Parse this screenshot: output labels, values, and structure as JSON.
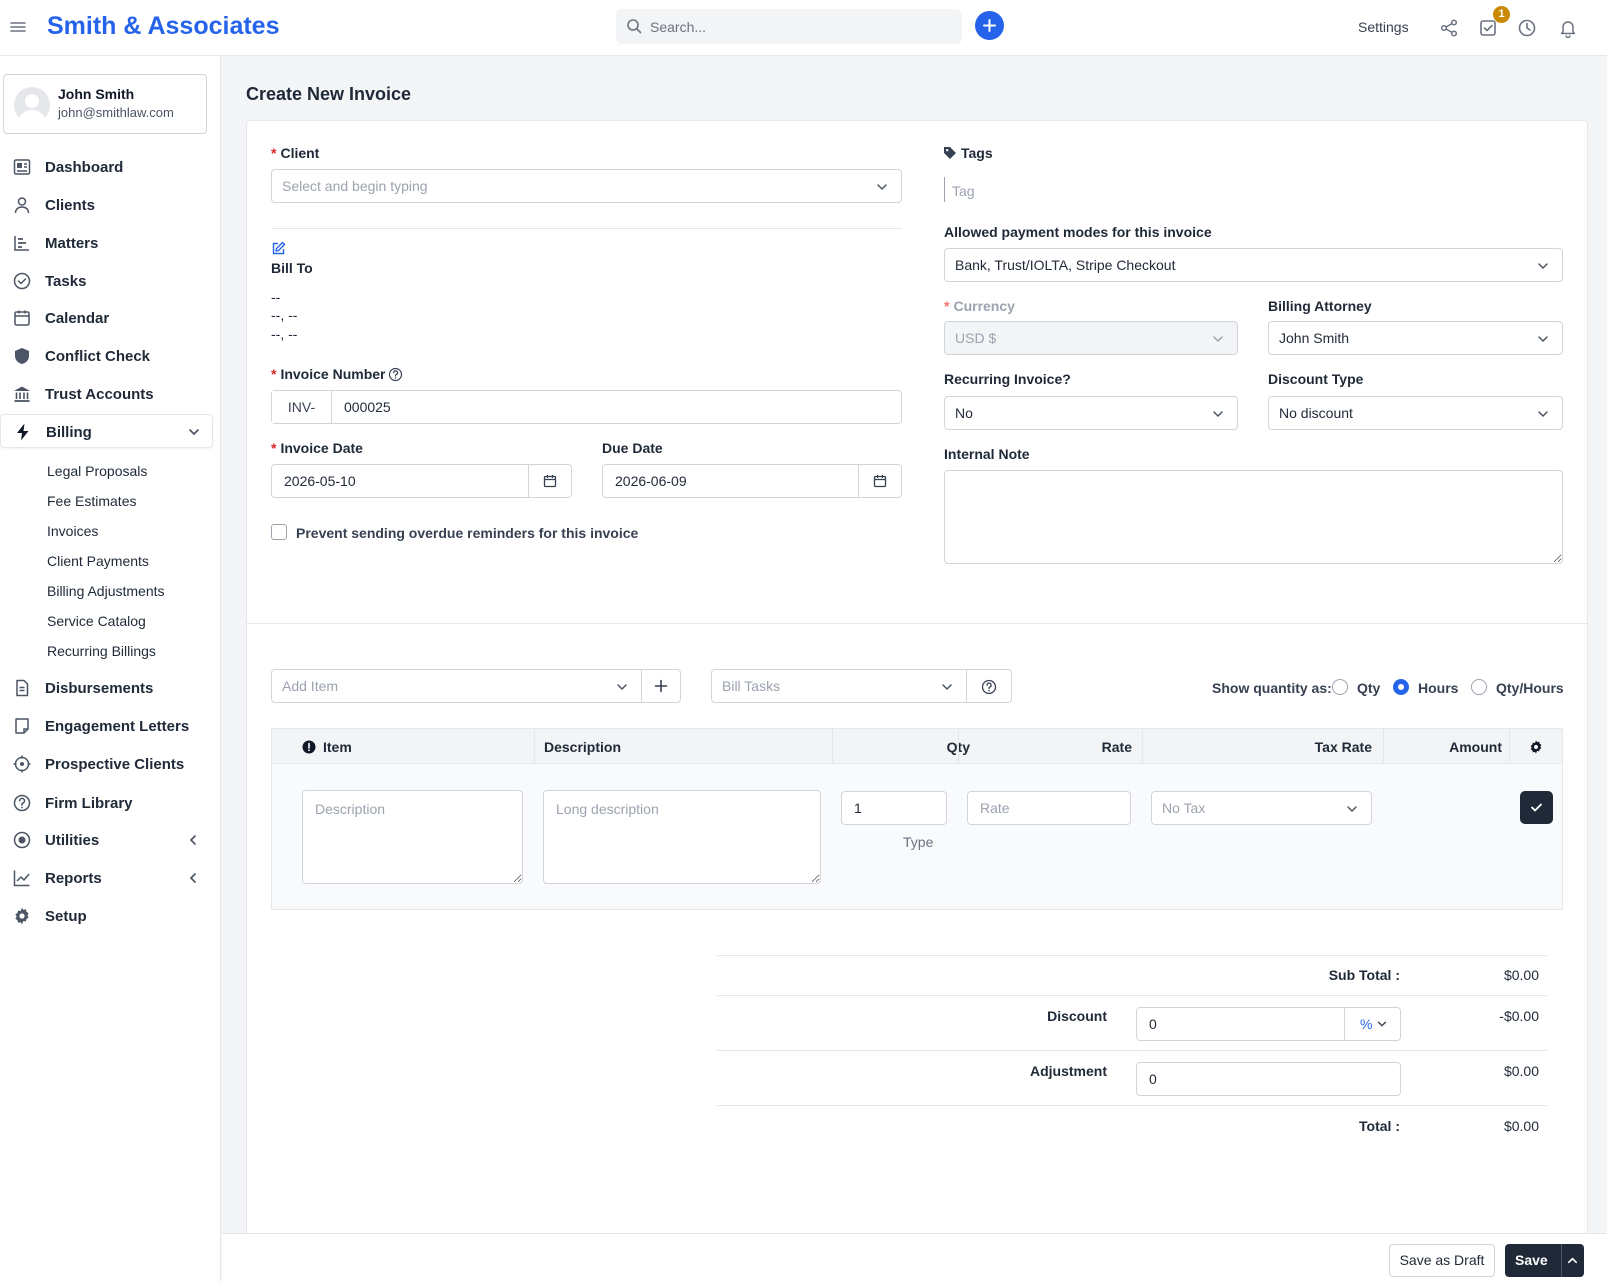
{
  "header": {
    "brand": "Smith & Associates",
    "search_placeholder": "Search...",
    "settings_label": "Settings",
    "tasks_badge": "1"
  },
  "user": {
    "name": "John Smith",
    "email": "john@smithlaw.com"
  },
  "nav": {
    "dashboard": "Dashboard",
    "clients": "Clients",
    "matters": "Matters",
    "tasks": "Tasks",
    "calendar": "Calendar",
    "conflict_check": "Conflict Check",
    "trust_accounts": "Trust Accounts",
    "billing": "Billing",
    "billing_sub": [
      "Legal Proposals",
      "Fee Estimates",
      "Invoices",
      "Client Payments",
      "Billing Adjustments",
      "Service Catalog",
      "Recurring Billings"
    ],
    "disbursements": "Disbursements",
    "engagement_letters": "Engagement Letters",
    "prospective_clients": "Prospective Clients",
    "firm_library": "Firm Library",
    "utilities": "Utilities",
    "reports": "Reports",
    "setup": "Setup"
  },
  "page": {
    "title": "Create New Invoice"
  },
  "form": {
    "client_label": "Client",
    "client_placeholder": "Select and begin typing",
    "bill_to_label": "Bill To",
    "bill_to_lines": [
      "--",
      "--, --",
      "--, --"
    ],
    "invoice_number_label": "Invoice Number",
    "invoice_prefix": "INV-",
    "invoice_number": "000025",
    "invoice_date_label": "Invoice Date",
    "invoice_date": "2026-05-10",
    "due_date_label": "Due Date",
    "due_date": "2026-06-09",
    "prevent_reminders_label": "Prevent sending overdue reminders for this invoice",
    "tags_label": "Tags",
    "tag_placeholder": "Tag",
    "payment_modes_label": "Allowed payment modes for this invoice",
    "payment_modes_value": "Bank, Trust/IOLTA, Stripe Checkout",
    "currency_label": "Currency",
    "currency_value": "USD $",
    "billing_attorney_label": "Billing Attorney",
    "billing_attorney_value": "John Smith",
    "recurring_label": "Recurring Invoice?",
    "recurring_value": "No",
    "discount_type_label": "Discount Type",
    "discount_type_value": "No discount",
    "internal_note_label": "Internal Note"
  },
  "items": {
    "add_item_placeholder": "Add Item",
    "bill_tasks_placeholder": "Bill Tasks",
    "show_qty_label": "Show quantity as:",
    "qty_options": [
      "Qty",
      "Hours",
      "Qty/Hours"
    ],
    "qty_selected": "Hours",
    "columns": [
      "Item",
      "Description",
      "Qty",
      "Rate",
      "Tax Rate",
      "Amount"
    ],
    "row": {
      "description_placeholder": "Description",
      "long_description_placeholder": "Long description",
      "qty": "1",
      "type_label": "Type",
      "rate_placeholder": "Rate",
      "tax_value": "No Tax"
    }
  },
  "totals": {
    "sub_total_label": "Sub Total :",
    "sub_total": "$0.00",
    "discount_label": "Discount",
    "discount_input": "0",
    "discount_unit": "%",
    "discount_value": "-$0.00",
    "adjustment_label": "Adjustment",
    "adjustment_input": "0",
    "adjustment_value": "$0.00",
    "total_label": "Total :",
    "total": "$0.00"
  },
  "footer": {
    "save_draft": "Save as Draft",
    "save": "Save"
  }
}
